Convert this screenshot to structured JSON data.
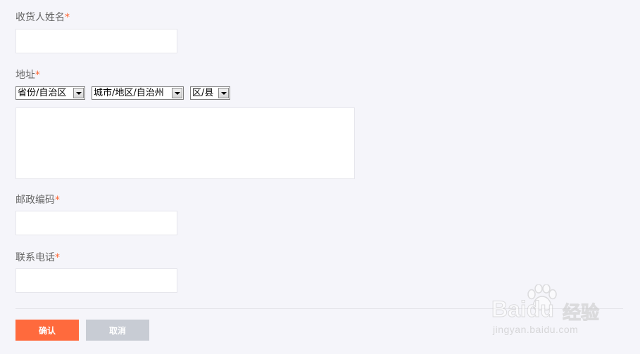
{
  "form": {
    "name_field": {
      "label": "收货人姓名",
      "required_mark": "*",
      "value": ""
    },
    "address_field": {
      "label": "地址",
      "required_mark": "*",
      "province_select": "省份/自治区",
      "city_select": "城市/地区/自治州",
      "district_select": "区/县",
      "detail_value": ""
    },
    "postcode_field": {
      "label": "邮政编码",
      "required_mark": "*",
      "value": ""
    },
    "phone_field": {
      "label": "联系电话",
      "required_mark": "*",
      "value": ""
    },
    "buttons": {
      "confirm": "确认",
      "cancel": "取消"
    }
  },
  "watermark": {
    "brand": "Baidu",
    "product": "经验",
    "url": "jingyan.baidu.com"
  },
  "colors": {
    "background": "#f5f5fa",
    "required": "#ff6633",
    "confirm_button": "#ff6a3d",
    "cancel_button": "#c8ccd4"
  }
}
